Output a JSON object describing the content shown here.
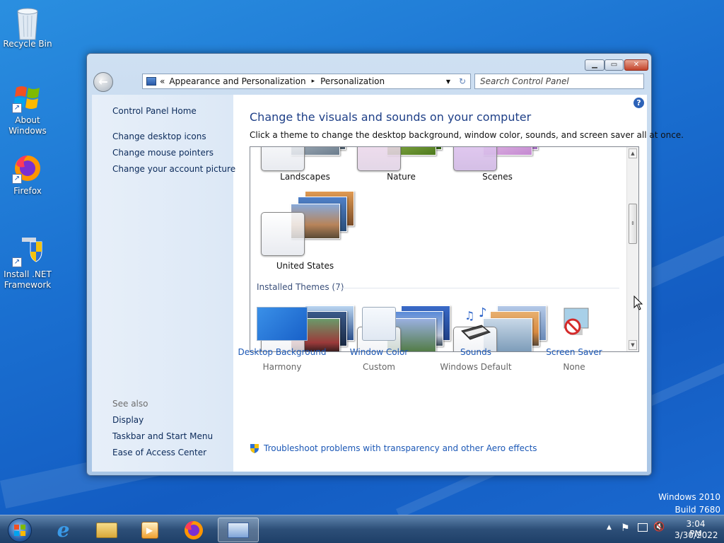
{
  "desktop": {
    "icons": [
      {
        "label": "Recycle Bin",
        "icon": "recycle-bin-icon"
      },
      {
        "label": "About Windows",
        "icon": "windows-logo-icon"
      },
      {
        "label": "Firefox",
        "icon": "firefox-icon"
      },
      {
        "label": "Install .NET Framework",
        "icon": "shield-installer-icon"
      }
    ],
    "watermark": {
      "line1": "Windows 2010",
      "line2": "Build 7680"
    }
  },
  "window": {
    "titlebar": {
      "minimize": "minimize-icon",
      "maximize": "maximize-icon",
      "close": "close-icon"
    },
    "address": {
      "chevrons": "«",
      "crumb1": "Appearance and Personalization",
      "separator": "▸",
      "crumb2": "Personalization"
    },
    "search": {
      "placeholder": "Search Control Panel"
    },
    "sidebar": {
      "home": "Control Panel Home",
      "links": [
        "Change desktop icons",
        "Change mouse pointers",
        "Change your account picture"
      ],
      "see_also_title": "See also",
      "see_also": [
        "Display",
        "Taskbar and Start Menu",
        "Ease of Access Center"
      ]
    },
    "main": {
      "heading": "Change the visuals and sounds on your computer",
      "subheading": "Click a theme to change the desktop background, window color, sounds, and screen saver all at once.",
      "themes": [
        {
          "name": "Landscapes"
        },
        {
          "name": "Nature"
        },
        {
          "name": "Scenes"
        },
        {
          "name": "United States"
        }
      ],
      "installed_title": "Installed Themes (7)",
      "bottom": [
        {
          "title": "Desktop Background",
          "sub": "Harmony",
          "icon": "desktop-background-icon"
        },
        {
          "title": "Window Color",
          "sub": "Custom",
          "icon": "window-color-icon"
        },
        {
          "title": "Sounds",
          "sub": "Windows Default",
          "icon": "sounds-icon"
        },
        {
          "title": "Screen Saver",
          "sub": "None",
          "icon": "screen-saver-icon"
        }
      ],
      "troubleshoot": "Troubleshoot problems with transparency and other Aero effects"
    }
  },
  "taskbar": {
    "items": [
      "start-orb-icon",
      "internet-explorer-icon",
      "windows-explorer-icon",
      "media-player-icon",
      "firefox-icon",
      "control-panel-icon"
    ],
    "time": "3:04 PM",
    "date": "3/30/2022"
  },
  "colors": {
    "accent": "#1c58b6",
    "heading": "#1e3f87"
  }
}
